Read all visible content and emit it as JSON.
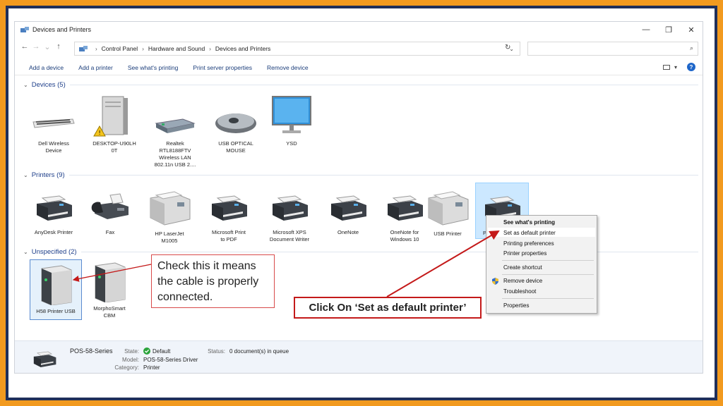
{
  "window": {
    "title": "Devices and Printers",
    "controls": {
      "minimize": "—",
      "maximize": "❐",
      "close": "✕"
    }
  },
  "address": {
    "back": "←",
    "forward": "→",
    "recent": "⌄",
    "up": "↑",
    "crumbs": [
      "Control Panel",
      "Hardware and Sound",
      "Devices and Printers"
    ],
    "separator": "›",
    "dropdown": "⌄",
    "refresh": "↻",
    "search_value": "",
    "search_icon": "⌕"
  },
  "commands": [
    "Add a device",
    "Add a printer",
    "See what's printing",
    "Print server properties",
    "Remove device"
  ],
  "help_label": "?",
  "view_caret": "▾",
  "groups": {
    "devices": {
      "label": "Devices (5)",
      "caret": "⌄"
    },
    "printers": {
      "label": "Printers (9)",
      "caret": "⌄"
    },
    "unspecified": {
      "label": "Unspecified (2)",
      "caret": "⌄"
    }
  },
  "devices": [
    {
      "line1": "Dell Wireless",
      "line2": "Device",
      "line3": "",
      "line4": ""
    },
    {
      "line1": "DESKTOP-U90LH",
      "line2": "0T",
      "line3": "",
      "line4": ""
    },
    {
      "line1": "Realtek",
      "line2": "RTL8188FTV",
      "line3": "Wireless LAN",
      "line4": "802.11n USB 2...."
    },
    {
      "line1": "USB OPTICAL",
      "line2": "MOUSE",
      "line3": "",
      "line4": ""
    },
    {
      "line1": "YSD",
      "line2": "",
      "line3": "",
      "line4": ""
    }
  ],
  "printers": [
    {
      "line1": "AnyDesk Printer",
      "line2": ""
    },
    {
      "line1": "Fax",
      "line2": ""
    },
    {
      "line1": "HP LaserJet",
      "line2": "M1005"
    },
    {
      "line1": "Microsoft Print",
      "line2": "to PDF"
    },
    {
      "line1": "Microsoft XPS",
      "line2": "Document Writer"
    },
    {
      "line1": "OneNote",
      "line2": ""
    },
    {
      "line1": "OneNote for",
      "line2": "Windows 10"
    },
    {
      "line1": "USB Printer",
      "line2": ""
    },
    {
      "line1": "P",
      "line2": ""
    }
  ],
  "unspecified": [
    {
      "line1": "H58 Printer USB",
      "line2": ""
    },
    {
      "line1": "MorphoSmart",
      "line2": "CBM"
    }
  ],
  "context_menu": {
    "items": [
      "See what's printing",
      "Set as default printer",
      "Printing preferences",
      "Printer properties",
      "Create shortcut",
      "Remove device",
      "Troubleshoot",
      "Properties"
    ]
  },
  "details": {
    "name": "POS-58-Series",
    "state_label": "State:",
    "state_value": "Default",
    "status_label": "Status:",
    "status_value": "0 document(s) in queue",
    "model_label": "Model:",
    "model_value": "POS-58-Series Driver",
    "category_label": "Category:",
    "category_value": "Printer"
  },
  "annotations": {
    "callout1": "Check this it means the cable is properly connected.",
    "callout2": "Click On ‘Set as default printer’"
  },
  "colors": {
    "frame": "#f29a1f",
    "border": "#1f2f5a",
    "callout_red": "#c41a1a",
    "link_blue": "#1b3d7a"
  }
}
